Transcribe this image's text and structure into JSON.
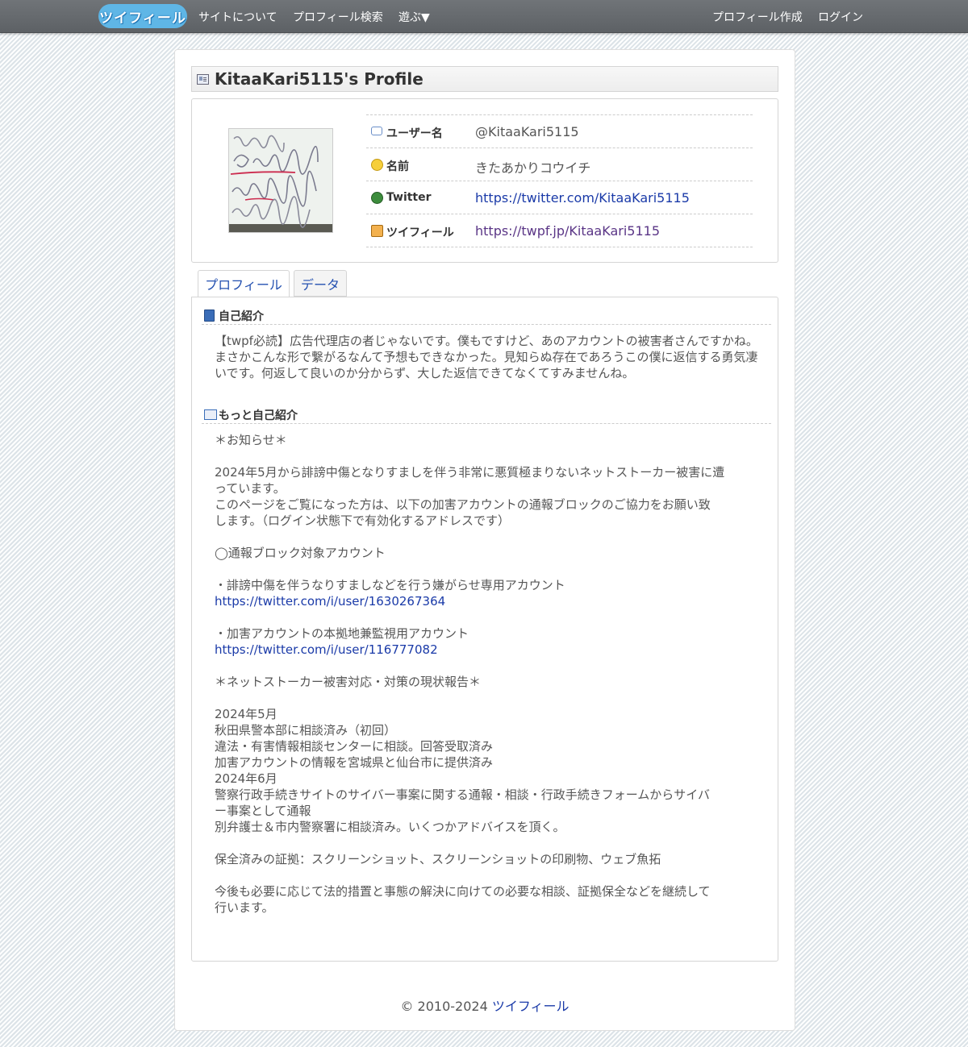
{
  "nav": {
    "logo_text": "ツイフィール",
    "about": "サイトについて",
    "search": "プロフィール検索",
    "play": "遊ぶ▼",
    "create": "プロフィール作成",
    "login": "ログイン"
  },
  "profile": {
    "title": "KitaaKari5115's Profile",
    "username_label": "ユーザー名",
    "username_value": "@KitaaKari5115",
    "name_label": "名前",
    "name_value": "きたあかりコウイチ",
    "twitter_label": "Twitter",
    "twitter_value": "https://twitter.com/KitaaKari5115",
    "twpf_label": "ツイフィール",
    "twpf_value": "https://twpf.jp/KitaaKari5115"
  },
  "tabs": {
    "profile": "プロフィール",
    "data": "データ"
  },
  "intro": {
    "heading": "自己紹介",
    "text": "【twpf必読】広告代理店の者じゃないです。僕もですけど、あのアカウントの被害者さんですかね。まさかこんな形で繋がるなんて予想もできなかった。見知らぬ存在であろうこの僕に返信する勇気凄いです。何返して良いのか分からず、大した返信できてなくてすみませんね。"
  },
  "more": {
    "heading": "もっと自己紹介",
    "lines": [
      "＊お知らせ＊",
      "",
      "2024年5月から誹謗中傷となりすましを伴う非常に悪質極まりないネットストーカー被害に遭",
      "っています。",
      "このページをご覧になった方は、以下の加害アカウントの通報ブロックのご協力をお願い致",
      "します。（ログイン状態下で有効化するアドレスです）",
      "",
      "◯通報ブロック対象アカウント",
      "",
      "・誹謗中傷を伴うなりすましなどを行う嫌がらせ専用アカウント",
      "https://twitter.com/i/user/1630267364",
      "",
      "・加害アカウントの本拠地兼監視用アカウント",
      "https://twitter.com/i/user/116777082",
      "",
      "＊ネットストーカー被害対応・対策の現状報告＊",
      "",
      "2024年5月",
      "秋田県警本部に相談済み（初回）",
      "違法・有害情報相談センターに相談。回答受取済み",
      "加害アカウントの情報を宮城県と仙台市に提供済み",
      "2024年6月",
      "警察行政手続きサイトのサイバー事案に関する通報・相談・行政手続きフォームからサイバ",
      "ー事案として通報",
      "別弁護士＆市内警察署に相談済み。いくつかアドバイスを頂く。",
      "",
      "保全済みの証拠：スクリーンショット、スクリーンショットの印刷物、ウェブ魚拓",
      "",
      "今後も必要に応じて法的措置と事態の解決に向けての必要な相談、証拠保全などを継続して",
      "行います。"
    ]
  },
  "footer": {
    "copyright": "© 2010-2024",
    "site": "ツイフィール"
  },
  "colors": {
    "link": "#1a3aa8",
    "topbar": "#666a6e",
    "logo": "#5fb6e6"
  }
}
